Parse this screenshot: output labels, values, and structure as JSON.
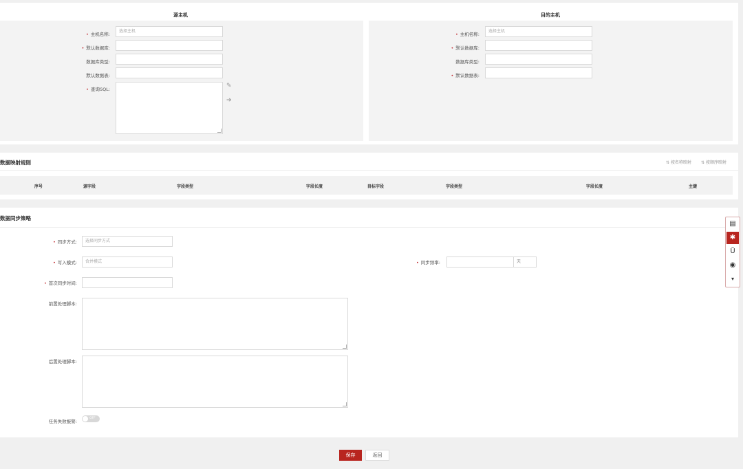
{
  "hosts": {
    "source": {
      "title": "源主机",
      "host_name_label": "主机名称:",
      "host_name_placeholder": "选择主机",
      "default_db_label": "默认数据库:",
      "db_type_label": "数据库类型:",
      "default_table_label": "默认数据表:",
      "query_sql_label": "查询SQL:"
    },
    "target": {
      "title": "目的主机",
      "host_name_label": "主机名称:",
      "host_name_placeholder": "选择主机",
      "default_db_label": "默认数据库:",
      "db_type_label": "数据库类型:",
      "default_table_label": "默认数据表:"
    }
  },
  "mapping": {
    "title": "数据映射规则",
    "map_by_name": "按名称映射",
    "map_by_order": "按顺序映射",
    "columns": [
      "序号",
      "源字段",
      "字段类型",
      "字段长度",
      "目标字段",
      "字段类型",
      "字段长度",
      "主键"
    ]
  },
  "strategy": {
    "title": "数据同步策略",
    "sync_mode_label": "同步方式:",
    "sync_mode_placeholder": "选择同步方式",
    "write_mode_label": "写入模式:",
    "write_mode_placeholder": "合并模式",
    "sync_freq_label": "同步频率:",
    "sync_freq_unit": "天",
    "first_sync_label": "首次同步时间:",
    "pre_script_label": "前置处理脚本:",
    "post_script_label": "后置处理脚本:",
    "fail_alert_label": "任务失败报警:",
    "fail_alert_state": "OFF"
  },
  "footer": {
    "save_label": "保存",
    "back_label": "返回"
  },
  "toolbar": {
    "icons": [
      "document-icon",
      "gear-icon",
      "magnet-icon",
      "target-icon",
      "caret-down-icon"
    ],
    "accent": "#b8251f"
  }
}
